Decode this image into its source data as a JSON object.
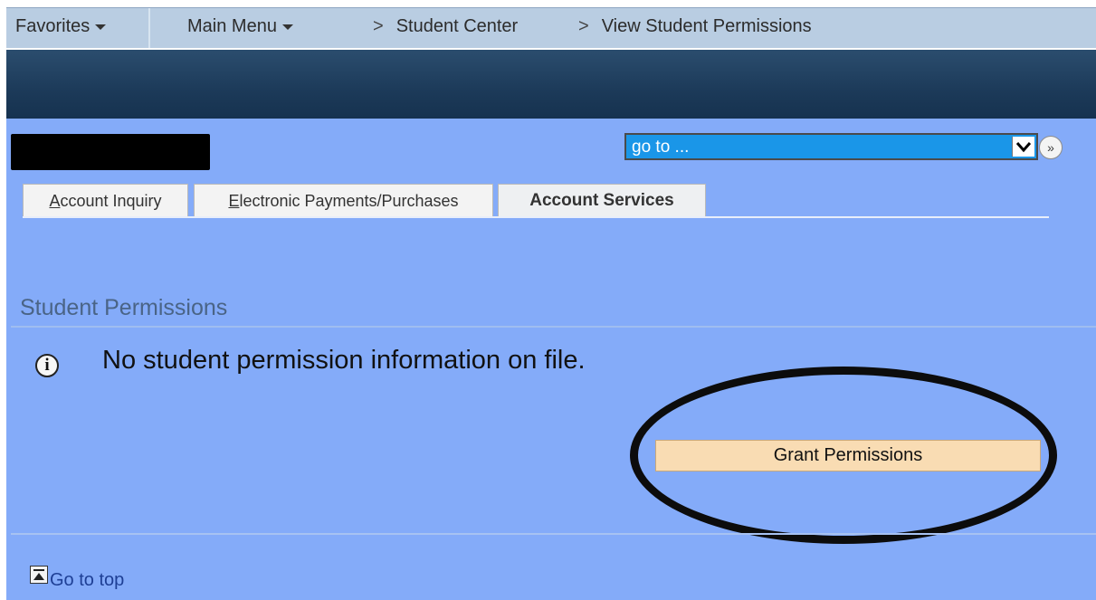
{
  "nav": {
    "favorites": "Favorites",
    "main_menu": "Main Menu",
    "crumb1": "Student Center",
    "crumb2": "View Student Permissions",
    "separator": ">"
  },
  "goto": {
    "selected": "go to ...",
    "go_button": "»"
  },
  "tabs": {
    "account_inquiry": {
      "first": "A",
      "rest": "ccount Inquiry"
    },
    "electronic_payments": {
      "first": "E",
      "rest": "lectronic Payments/Purchases"
    },
    "account_services": "Account Services"
  },
  "section": {
    "title": "Student Permissions",
    "info_glyph": "i",
    "message": "No student permission information on file."
  },
  "actions": {
    "grant": "Grant Permissions",
    "go_to_top": "Go to top"
  },
  "colors": {
    "content_bg": "#84abf9",
    "nav_bg": "#b9cde2",
    "banner": "#1c3a59",
    "goto_bg": "#1a96e8",
    "grant_bg": "#f9dcb3"
  }
}
